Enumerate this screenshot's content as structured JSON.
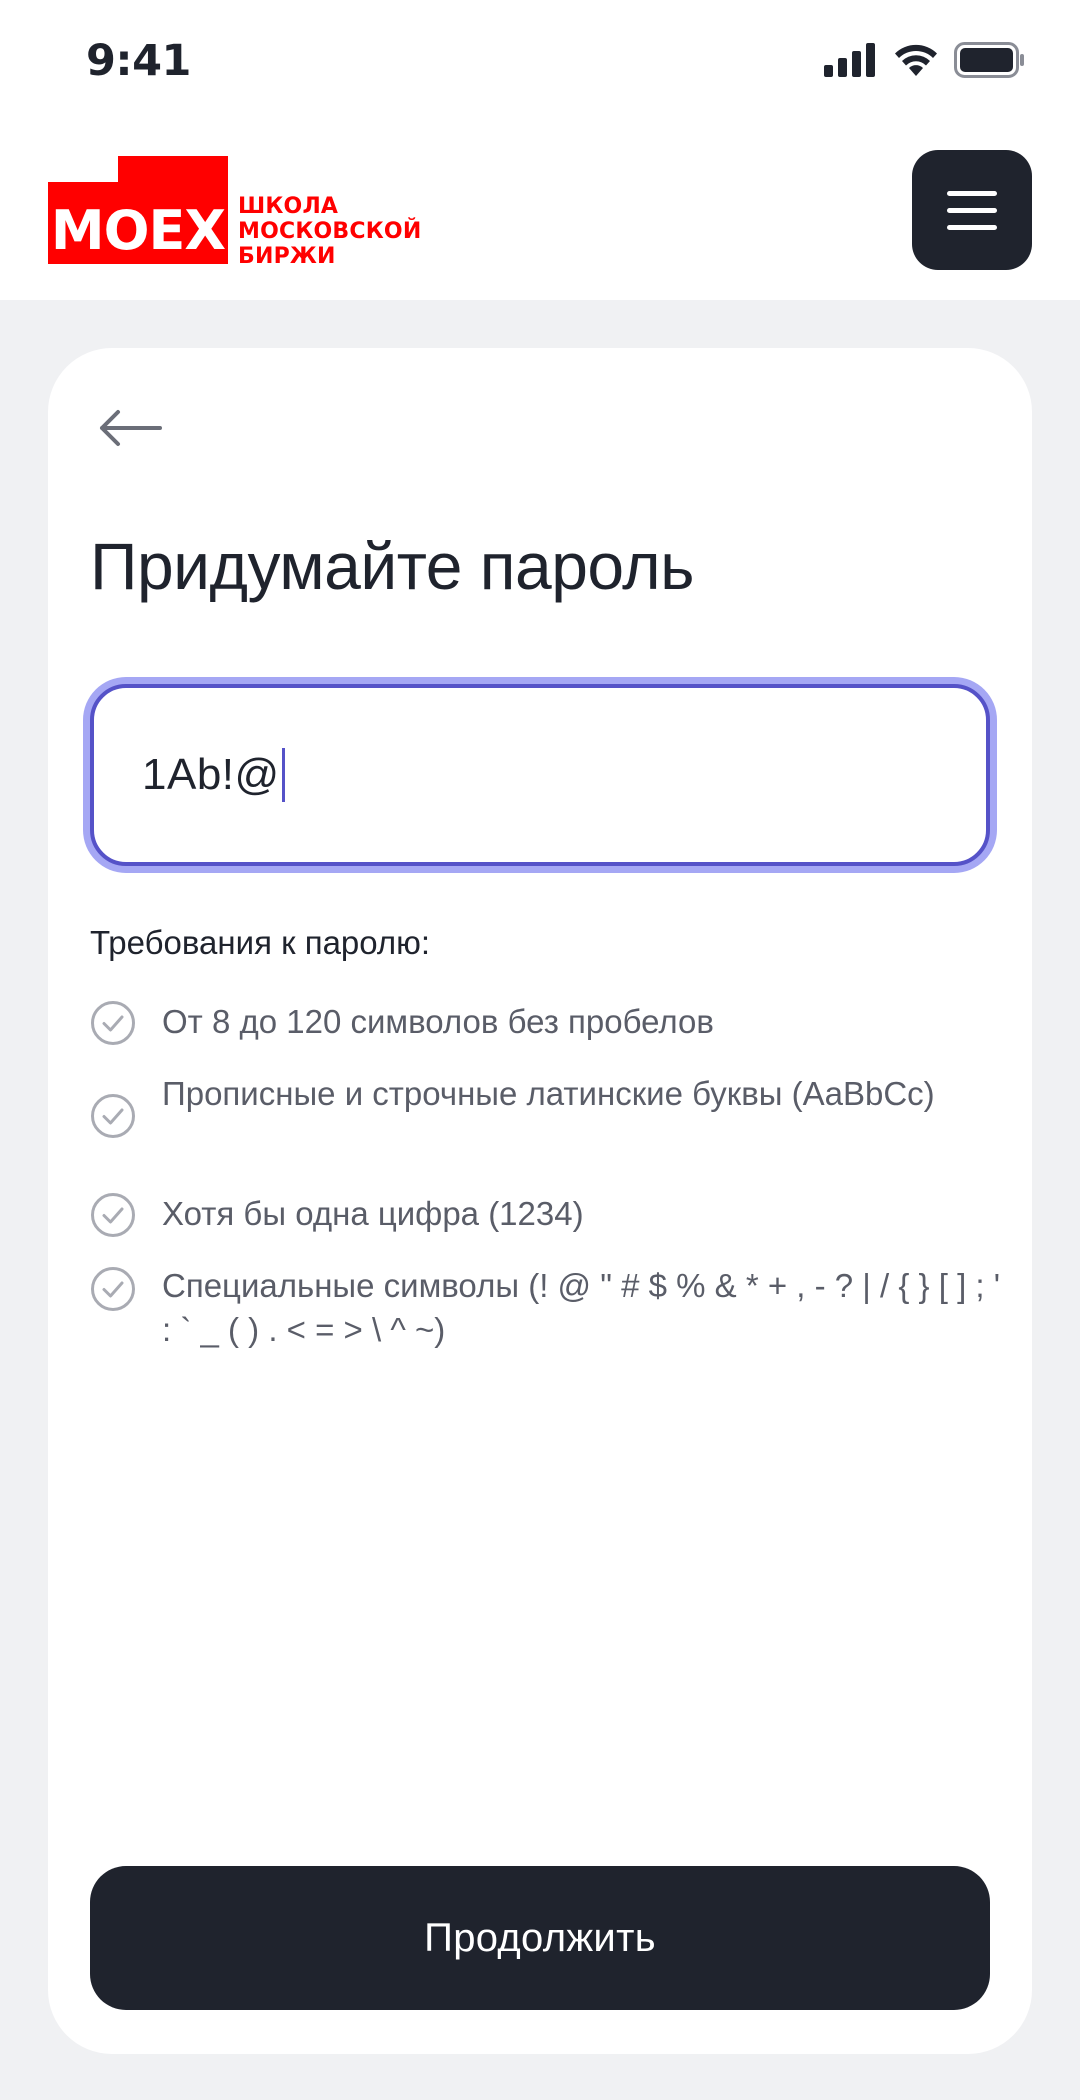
{
  "status_bar": {
    "time": "9:41",
    "icons": [
      "signal-icon",
      "wifi-icon",
      "battery-icon"
    ]
  },
  "header": {
    "logo": {
      "mark": "MOEX",
      "lines": [
        "ШКОЛА",
        "МОСКОВСКОЙ",
        "БИРЖИ"
      ]
    },
    "menu_icon": "hamburger-menu-icon"
  },
  "form": {
    "back_icon": "arrow-left-icon",
    "title": "Придумайте пароль",
    "password_value": "1Ab!@",
    "requirements_title": "Требования к паролю:",
    "requirements": [
      {
        "text": "От 8 до 120 символов без пробелов",
        "icon": "check-circle-icon"
      },
      {
        "text": "Прописные и строчные латинские буквы (AaBbCc)",
        "icon": "check-circle-icon"
      },
      {
        "text": "Хотя бы одна цифра (1234)",
        "icon": "check-circle-icon"
      },
      {
        "text": "Специальные символы (! @ \" # $ % & * + , - ? | / { } [ ] ; ' : ` _ ( ) . < = > \\ ^ ~)",
        "icon": "check-circle-icon"
      }
    ],
    "continue_label": "Продолжить"
  },
  "colors": {
    "brand_red": "#ff0000",
    "dark": "#1f232d",
    "focus": "#5552c8",
    "background": "#f0f1f3"
  }
}
